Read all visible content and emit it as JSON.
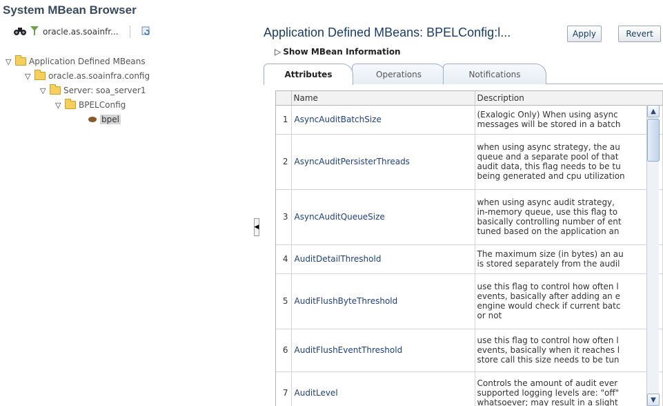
{
  "left": {
    "title": "System MBean Browser",
    "toolbar": {
      "domain_filter": "oracle.as.soainfr..."
    },
    "tree": [
      {
        "label": "Application Defined MBeans"
      },
      {
        "label": "oracle.as.soainfra.config"
      },
      {
        "label": "Server: soa_server1"
      },
      {
        "label": "BPELConfig"
      },
      {
        "label": "bpel"
      }
    ]
  },
  "right": {
    "title": "Application Defined MBeans: BPELConfig:l...",
    "apply_label": "Apply",
    "revert_label": "Revert",
    "show_info": "Show MBean Information",
    "tabs": [
      "Attributes",
      "Operations",
      "Notifications"
    ],
    "active_tab": "Attributes",
    "columns": {
      "name": "Name",
      "description": "Description"
    },
    "rows": [
      {
        "num": "1",
        "name": "AsyncAuditBatchSize",
        "desc": [
          "(Exalogic Only) When using async",
          "messages will be stored in a batch"
        ]
      },
      {
        "num": "2",
        "name": "AsyncAuditPersisterThreads",
        "desc": [
          "when using async strategy, the au",
          "queue and a separate pool of that",
          "audit data, this flag needs to be tu",
          "being generated and cpu utilization"
        ]
      },
      {
        "num": "3",
        "name": "AsyncAuditQueueSize",
        "desc": [
          "when using async audit strategy,",
          "in-memory queue, use this flag to",
          "basically controlling number of ent",
          "tuned based on the application an"
        ]
      },
      {
        "num": "4",
        "name": "AuditDetailThreshold",
        "desc": [
          "The maximum size (in bytes) an au",
          "is stored separately from the audil"
        ]
      },
      {
        "num": "5",
        "name": "AuditFlushByteThreshold",
        "desc": [
          "use this flag to control how often l",
          "events, basically after adding an e",
          "engine would check if current batc",
          "or not"
        ]
      },
      {
        "num": "6",
        "name": "AuditFlushEventThreshold",
        "desc": [
          "use this flag to control how often l",
          "events, basically when it reaches l",
          "store call this size needs to be tun"
        ]
      },
      {
        "num": "7",
        "name": "AuditLevel",
        "desc": [
          "Controls the amount of audit ever",
          "supported logging levels are: \"off\"",
          "whatsoever; may result in a slight"
        ]
      }
    ]
  }
}
